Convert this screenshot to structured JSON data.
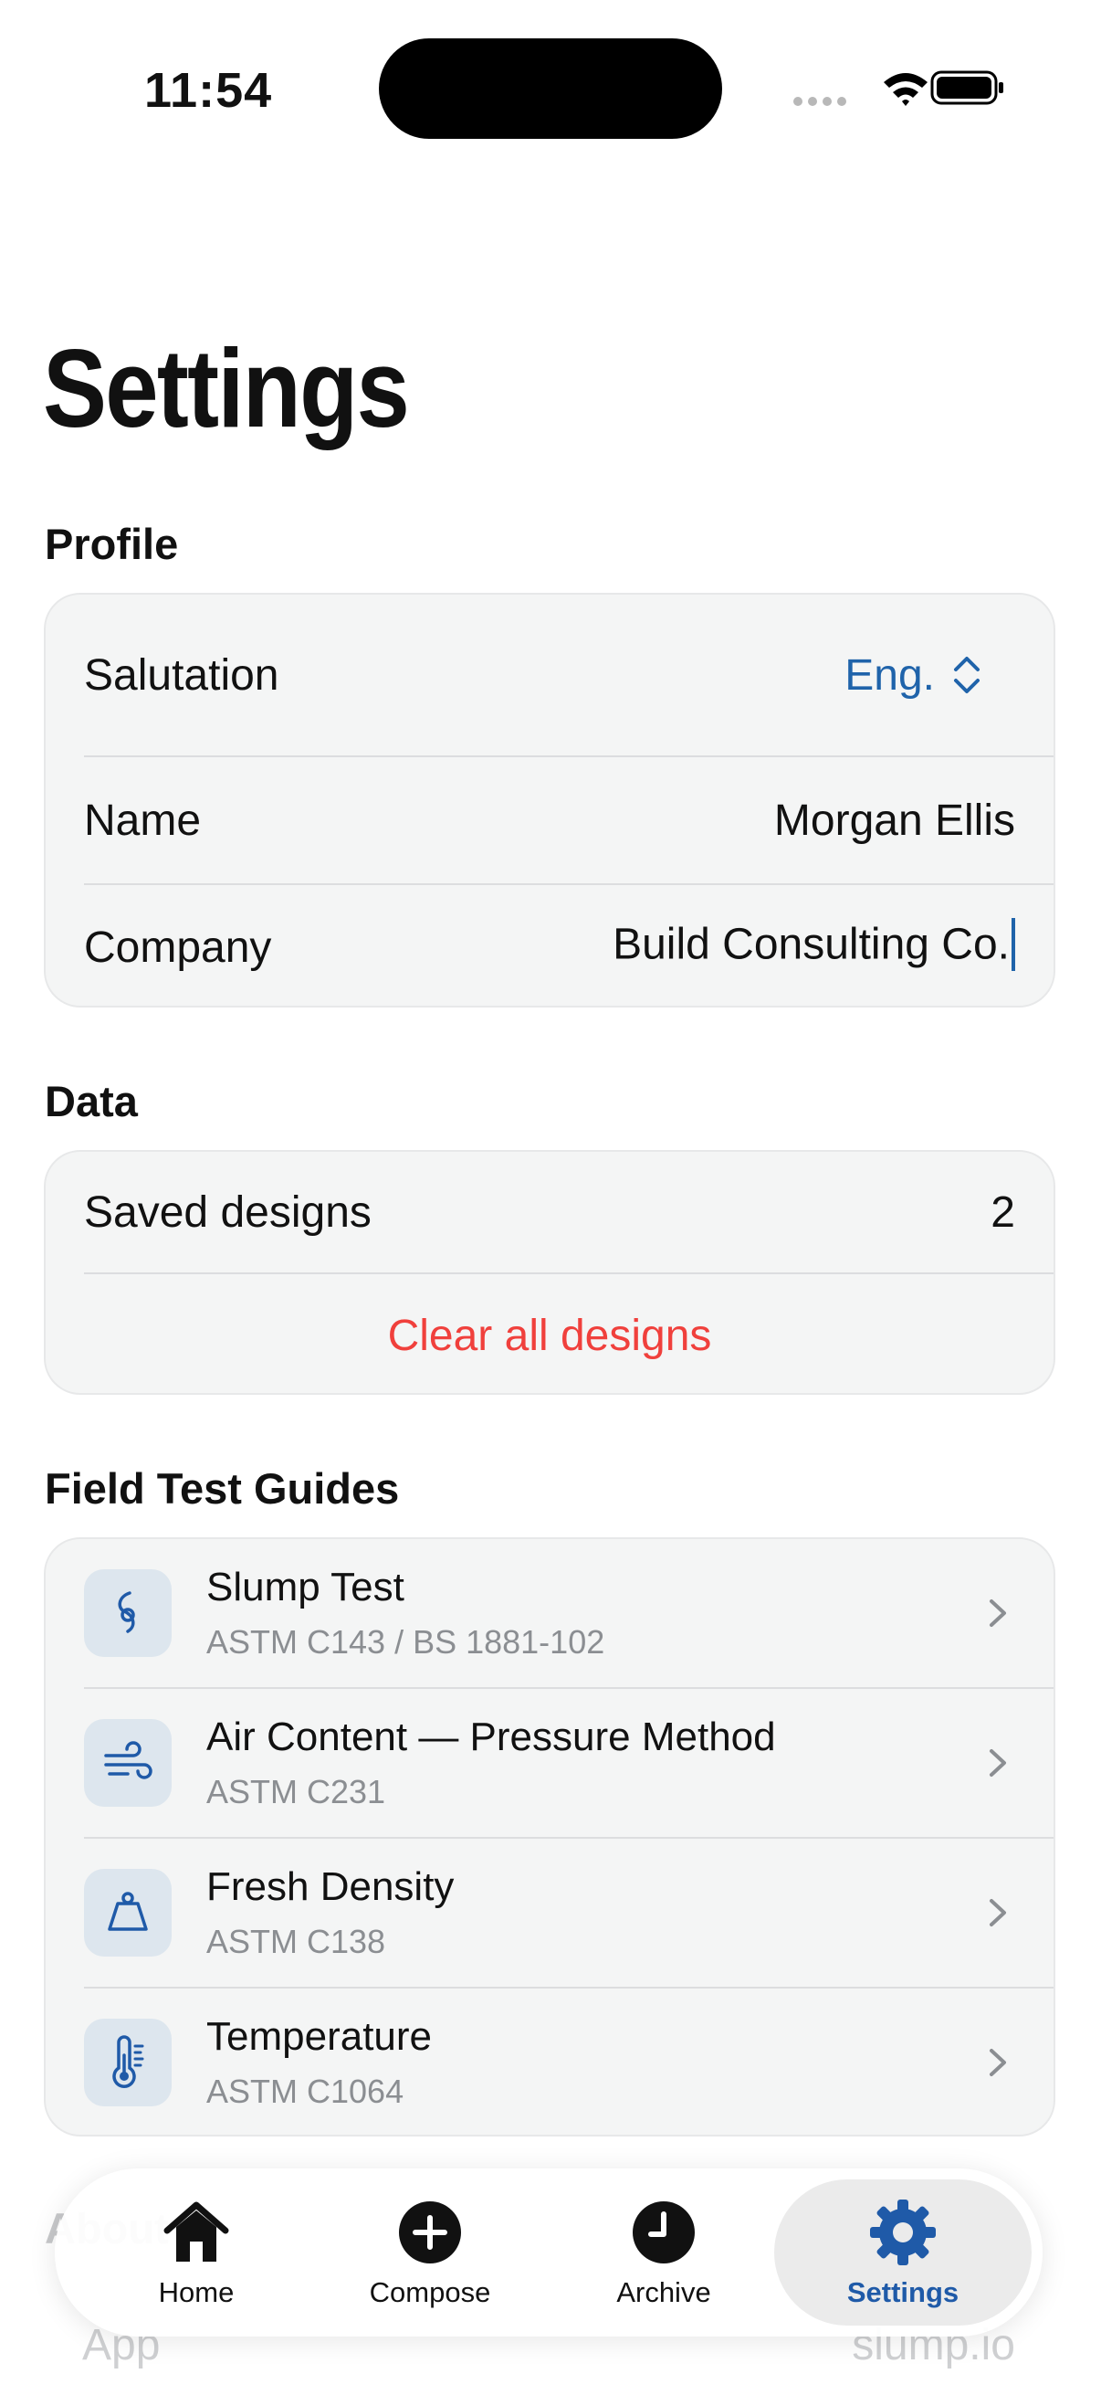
{
  "status_bar": {
    "time": "11:54",
    "icons": [
      "signal-dots-icon",
      "wifi-icon",
      "battery-icon"
    ]
  },
  "page": {
    "title": "Settings"
  },
  "profile": {
    "header": "Profile",
    "salutation_label": "Salutation",
    "salutation_value": "Eng.",
    "name_label": "Name",
    "name_value": "Morgan Ellis",
    "company_label": "Company",
    "company_value": "Build Consulting Co."
  },
  "data": {
    "header": "Data",
    "saved_label": "Saved designs",
    "saved_count": "2",
    "clear_label": "Clear all designs"
  },
  "guides": {
    "header": "Field Test Guides",
    "items": [
      {
        "title": "Slump Test",
        "subtitle": "ASTM C143 / BS 1881-102",
        "icon": "slump-cone-icon"
      },
      {
        "title": "Air Content — Pressure Method",
        "subtitle": "ASTM C231",
        "icon": "wind-icon"
      },
      {
        "title": "Fresh Density",
        "subtitle": "ASTM C138",
        "icon": "weight-icon"
      },
      {
        "title": "Temperature",
        "subtitle": "ASTM C1064",
        "icon": "thermometer-icon"
      }
    ]
  },
  "about": {
    "header": "About",
    "app_label": "App",
    "app_value": "slump.io"
  },
  "tab_bar": {
    "tabs": [
      {
        "label": "Home",
        "icon": "house-icon"
      },
      {
        "label": "Compose",
        "icon": "plus-circle-icon"
      },
      {
        "label": "Archive",
        "icon": "clock-icon"
      },
      {
        "label": "Settings",
        "icon": "gear-icon",
        "active": true
      }
    ]
  },
  "colors": {
    "accent": "#1f63aa",
    "danger": "#f0403c",
    "card_background": "#f4f5f5",
    "secondary_text": "#8b8e92"
  }
}
